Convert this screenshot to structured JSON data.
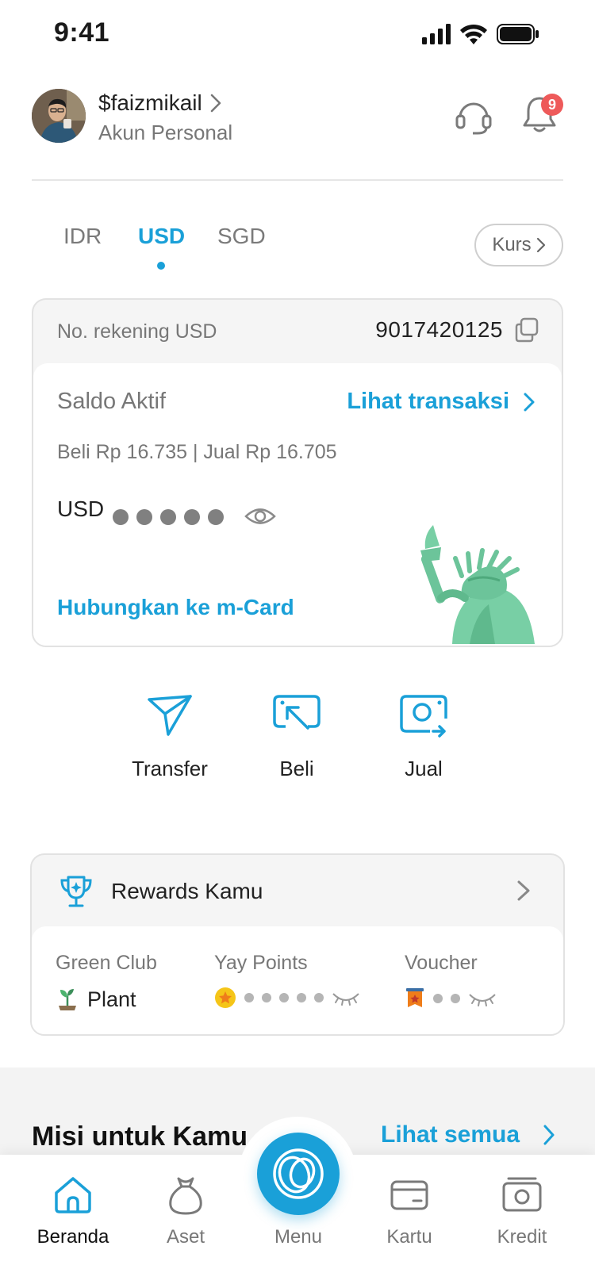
{
  "status_bar": {
    "time": "9:41"
  },
  "header": {
    "username": "$faizmikail",
    "account_type": "Akun Personal",
    "notification_count": "9"
  },
  "currency_tabs": [
    {
      "label": "IDR",
      "active": false
    },
    {
      "label": "USD",
      "active": true
    },
    {
      "label": "SGD",
      "active": false
    }
  ],
  "kurs_label": "Kurs",
  "account_card": {
    "account_label": "No. rekening USD",
    "account_number": "9017420125",
    "saldo_label": "Saldo Aktif",
    "transactions_link": "Lihat transaksi",
    "rates": "Beli Rp 16.735 | Jual Rp 16.705",
    "currency": "USD",
    "link_mcard": "Hubungkan ke m-Card"
  },
  "actions": [
    {
      "label": "Transfer",
      "icon": "send-icon"
    },
    {
      "label": "Beli",
      "icon": "buy-icon"
    },
    {
      "label": "Jual",
      "icon": "sell-icon"
    }
  ],
  "rewards": {
    "title": "Rewards Kamu",
    "green_club_label": "Green Club",
    "green_club_value": "Plant",
    "yay_points_label": "Yay Points",
    "voucher_label": "Voucher"
  },
  "missions": {
    "title": "Misi untuk Kamu",
    "see_all": "Lihat semua"
  },
  "bottom_nav": [
    {
      "label": "Beranda",
      "icon": "home-icon",
      "active": true
    },
    {
      "label": "Aset",
      "icon": "money-bag-icon",
      "active": false
    },
    {
      "label": "Menu",
      "icon": "menu-logo-icon",
      "active": false
    },
    {
      "label": "Kartu",
      "icon": "card-icon",
      "active": false
    },
    {
      "label": "Kredit",
      "icon": "credit-icon",
      "active": false
    }
  ],
  "colors": {
    "accent": "#1aa0d8",
    "badge": "#ee5a5a",
    "liberty": "#6cc49a"
  }
}
